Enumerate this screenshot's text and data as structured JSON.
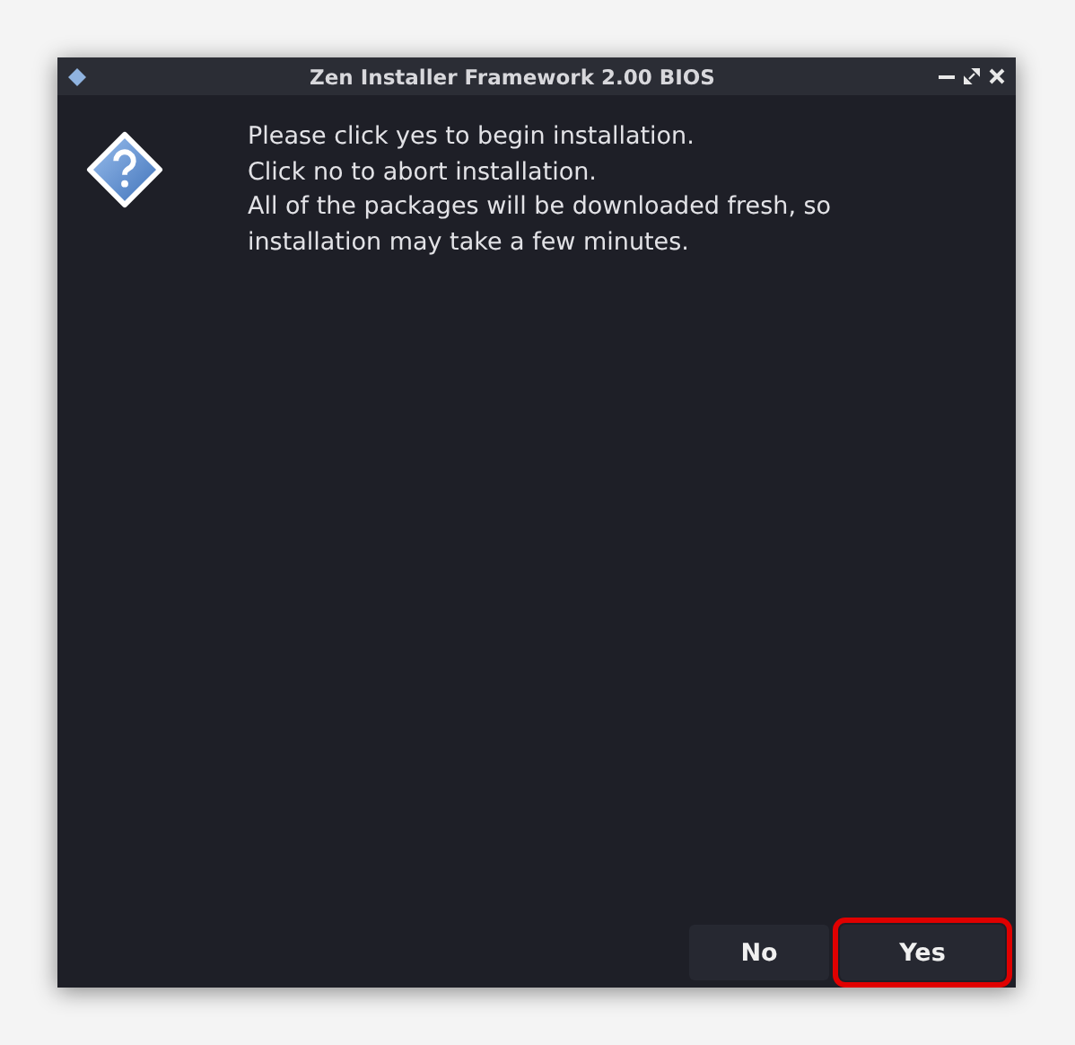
{
  "window": {
    "title": "Zen Installer Framework 2.00 BIOS"
  },
  "message": [
    "Please click yes to begin installation.",
    "Click no to abort installation.",
    "All of the packages will be downloaded fresh, so installation may take a few minutes."
  ],
  "buttons": [
    {
      "label": "No",
      "highlighted": false
    },
    {
      "label": "Yes",
      "highlighted": true
    }
  ]
}
